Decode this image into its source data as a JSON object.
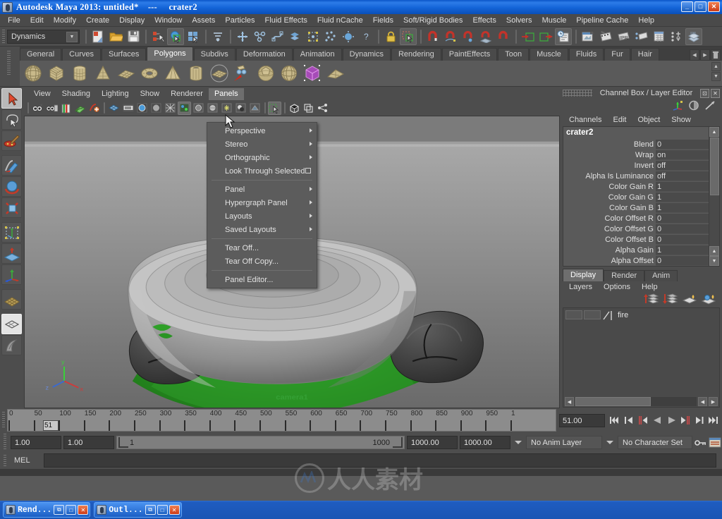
{
  "titlebar": {
    "title": "Autodesk Maya 2013: untitled*    ---     crater2",
    "minimize": "_",
    "maximize": "□",
    "close": "✕"
  },
  "menubar": {
    "items": [
      "File",
      "Edit",
      "Modify",
      "Create",
      "Display",
      "Window",
      "Assets",
      "Particles",
      "Fluid Effects",
      "Fluid nCache",
      "Fields",
      "Soft/Rigid Bodies",
      "Effects",
      "Solvers",
      "Muscle",
      "Pipeline Cache",
      "Help"
    ]
  },
  "statusline": {
    "menu_set": "Dynamics",
    "icons": [
      "new-scene-icon",
      "open-scene-icon",
      "save-scene-icon",
      "select-by-hierarchy-icon",
      "select-by-object-icon",
      "select-by-component-icon",
      "select-mask-icon",
      "snap-grid-icon",
      "snap-curve-icon",
      "snap-point-icon",
      "snap-view-plane-icon",
      "snap-live-icon",
      "construction-history-icon",
      "render-current-frame-icon",
      "ipr-render-icon",
      "render-sequence-icon",
      "render-settings-icon",
      "hypershade-icon",
      "rendering-editors-icon",
      "lock-icon",
      "highlight-selection-icon",
      "input-connection-icon",
      "output-connection-icon",
      "show-hide-icon",
      "move-tool-icon",
      "rotate-tool-icon",
      "scale-tool-icon",
      "help-icon"
    ]
  },
  "shelf": {
    "tabs": [
      "General",
      "Curves",
      "Surfaces",
      "Polygons",
      "Subdivs",
      "Deformation",
      "Animation",
      "Dynamics",
      "Rendering",
      "PaintEffects",
      "Toon",
      "Muscle",
      "Fluids",
      "Fur",
      "Hair"
    ],
    "active_tab": "Polygons",
    "nav_prev": "◀",
    "nav_next": "▶",
    "items": [
      "poly-sphere-icon",
      "poly-cube-icon",
      "poly-cylinder-icon",
      "poly-cone-icon",
      "poly-plane-icon",
      "poly-torus-icon",
      "poly-pyramid-icon",
      "poly-pipe-icon",
      "poly-prism-icon",
      "poly-helix-icon",
      "sculpt-geometry-icon",
      "poly-soccer-ball-icon",
      "poly-platonic-icon",
      "poly-boolean-icon",
      "poly-wedge-icon"
    ]
  },
  "toolbox": {
    "items": [
      "select-tool-icon",
      "lasso-select-tool-icon",
      "paint-select-tool-icon",
      "move-tool-icon",
      "rotate-tool-icon",
      "scale-tool-icon",
      "universal-manipulator-icon",
      "soft-modification-icon",
      "show-manipulator-icon",
      "last-tool-used-icon",
      "single-perspective-layout-icon",
      "four-view-layout-icon"
    ]
  },
  "viewport": {
    "menus": [
      "View",
      "Shading",
      "Lighting",
      "Show",
      "Renderer",
      "Panels"
    ],
    "active_menu": "Panels",
    "tool_icons": [
      "select-camera-icon",
      "camera-attributes-icon",
      "bookmark-icon",
      "image-plane-icon",
      "two-d-pan-zoom-icon",
      "grid-icon",
      "film-gate-icon",
      "resolution-gate-icon",
      "gate-mask-icon",
      "film-origin-icon",
      "smooth-shade-icon",
      "wireframe-on-shaded-icon",
      "textured-icon",
      "lights-icon",
      "shadows-icon",
      "xray-icon",
      "isolate-select-icon",
      "exposure-icon"
    ],
    "camera_label": "camera1",
    "axis_labels": {
      "y": "y",
      "x": "x",
      "z": "z"
    }
  },
  "panels_menu": {
    "items": [
      {
        "label": "Perspective",
        "submenu": true,
        "checkbox": false
      },
      {
        "label": "Stereo",
        "submenu": true,
        "checkbox": false
      },
      {
        "label": "Orthographic",
        "submenu": true,
        "checkbox": false
      },
      {
        "label": "Look Through Selected",
        "submenu": false,
        "checkbox": true
      },
      {
        "label": "Panel",
        "submenu": true,
        "checkbox": false,
        "sep_before": true
      },
      {
        "label": "Hypergraph Panel",
        "submenu": true,
        "checkbox": false
      },
      {
        "label": "Layouts",
        "submenu": true,
        "checkbox": false
      },
      {
        "label": "Saved Layouts",
        "submenu": true,
        "checkbox": false
      },
      {
        "label": "Tear Off...",
        "submenu": false,
        "checkbox": false,
        "sep_before": true
      },
      {
        "label": "Tear Off Copy...",
        "submenu": false,
        "checkbox": false
      },
      {
        "label": "Panel Editor...",
        "submenu": false,
        "checkbox": false,
        "sep_before": true
      }
    ]
  },
  "channel_box": {
    "title": "Channel Box / Layer Editor",
    "dock_button": "⊡",
    "close_button": "✕",
    "header_icons": [
      "channel-box-icon",
      "attribute-editor-icon",
      "tool-settings-icon"
    ],
    "menus": [
      "Channels",
      "Edit",
      "Object",
      "Show"
    ],
    "object_name": "crater2",
    "attributes": [
      {
        "name": "Blend",
        "value": "0"
      },
      {
        "name": "Wrap",
        "value": "on"
      },
      {
        "name": "Invert",
        "value": "off"
      },
      {
        "name": "Alpha Is Luminance",
        "value": "off"
      },
      {
        "name": "Color Gain R",
        "value": "1"
      },
      {
        "name": "Color Gain G",
        "value": "1"
      },
      {
        "name": "Color Gain B",
        "value": "1"
      },
      {
        "name": "Color Offset R",
        "value": "0"
      },
      {
        "name": "Color Offset G",
        "value": "0"
      },
      {
        "name": "Color Offset B",
        "value": "0"
      },
      {
        "name": "Alpha Gain",
        "value": "1"
      },
      {
        "name": "Alpha Offset",
        "value": "0"
      }
    ]
  },
  "layer_editor": {
    "tabs": [
      "Display",
      "Render",
      "Anim"
    ],
    "active_tab": "Display",
    "menus": [
      "Layers",
      "Options",
      "Help"
    ],
    "toolbar_icons": [
      "move-layer-up-icon",
      "move-layer-down-icon",
      "new-layer-icon",
      "new-layer-from-selected-icon"
    ],
    "layers": [
      {
        "name": "fire",
        "visibility": "V",
        "playback": ""
      }
    ]
  },
  "time_slider": {
    "ticks": [
      {
        "label": "0",
        "frame": 0
      },
      {
        "label": "50",
        "frame": 50
      },
      {
        "label": "100",
        "frame": 100
      },
      {
        "label": "150",
        "frame": 150
      },
      {
        "label": "200",
        "frame": 200
      },
      {
        "label": "250",
        "frame": 250
      },
      {
        "label": "300",
        "frame": 300
      },
      {
        "label": "350",
        "frame": 350
      },
      {
        "label": "400",
        "frame": 400
      },
      {
        "label": "450",
        "frame": 450
      },
      {
        "label": "500",
        "frame": 500
      },
      {
        "label": "550",
        "frame": 550
      },
      {
        "label": "600",
        "frame": 600
      },
      {
        "label": "650",
        "frame": 650
      },
      {
        "label": "700",
        "frame": 700
      },
      {
        "label": "750",
        "frame": 750
      },
      {
        "label": "800",
        "frame": 800
      },
      {
        "label": "850",
        "frame": 850
      },
      {
        "label": "900",
        "frame": 900
      },
      {
        "label": "950",
        "frame": 950
      },
      {
        "label": "1",
        "frame": 1000
      }
    ],
    "current_frame_marker": "51",
    "current_time_field": "51.00",
    "range_start": 0,
    "range_end": 1000,
    "playback_buttons": [
      "go-to-start-icon",
      "step-back-keyframe-icon",
      "step-back-frame-icon",
      "play-backwards-icon",
      "play-forwards-icon",
      "step-forward-frame-icon",
      "step-forward-keyframe-icon",
      "go-to-end-icon"
    ]
  },
  "range_slider": {
    "anim_start": "1.00",
    "anim_end": "1.00",
    "range_left_value": "1",
    "range_right_value": "1000",
    "playback_end": "1000.00",
    "anim_end_field": "1000.00",
    "anim_layer": "No Anim Layer",
    "character_set": "No Character Set",
    "key_icon": "auto-keyframe-icon",
    "prefs_icon": "animation-preferences-icon"
  },
  "command_line": {
    "label": "MEL",
    "value": "",
    "placeholder": ""
  },
  "taskbar": {
    "items": [
      {
        "label": "Rend...",
        "restore": "⧉",
        "maximize": "□",
        "close": "✕"
      },
      {
        "label": "Outl...",
        "restore": "⧉",
        "maximize": "□",
        "close": "✕"
      }
    ]
  },
  "watermark": {
    "text": "人人素材"
  },
  "colors": {
    "accent_blue": "#1a5fc0",
    "panel_bg": "#4d4d4d",
    "viewport_bg": "#6e6e6e",
    "green_highlight": "#2a9a2a",
    "camera_text": "#35a035"
  }
}
